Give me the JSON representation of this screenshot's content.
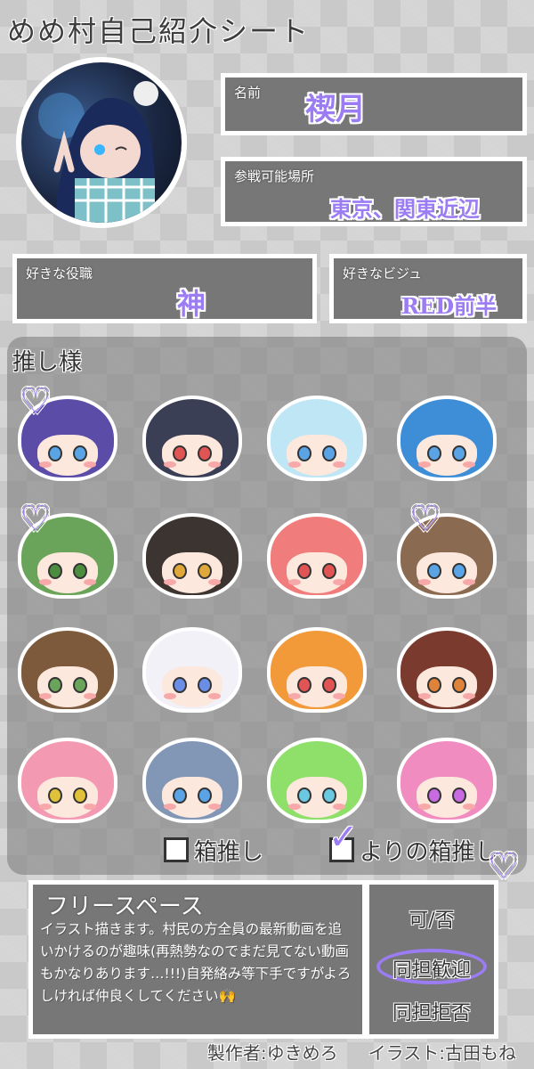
{
  "sheet": {
    "title": "めめ村自己紹介シート"
  },
  "profile": {
    "name_label": "名前",
    "name_value": "禊月",
    "area_label": "参戦可能場所",
    "area_value": "東京、関東近辺",
    "role_label": "好きな役職",
    "role_value": "神",
    "video_label": "好きなビジュ",
    "video_value": "RED前半"
  },
  "oshi": {
    "title": "推し様",
    "faces": [
      {
        "hair": "#5b4ca8",
        "eye": "#5aa4e6",
        "heart": true
      },
      {
        "hair": "#3a3f55",
        "eye": "#e05454",
        "heart": false
      },
      {
        "hair": "#bfe6f5",
        "eye": "#5aa4e6",
        "heart": false
      },
      {
        "hair": "#3d8ed6",
        "eye": "#5aa4e6",
        "heart": false
      },
      {
        "hair": "#6aa35a",
        "eye": "#4c8c3e",
        "heart": true
      },
      {
        "hair": "#3b3430",
        "eye": "#e0a73a",
        "heart": false
      },
      {
        "hair": "#f07c7c",
        "eye": "#e05454",
        "heart": false
      },
      {
        "hair": "#8b6a52",
        "eye": "#5aa4e6",
        "heart": true
      },
      {
        "hair": "#7d5a3c",
        "eye": "#6aa35a",
        "heart": false
      },
      {
        "hair": "#f1f1f7",
        "eye": "#6a8ee6",
        "heart": false
      },
      {
        "hair": "#f29a3a",
        "eye": "#e05454",
        "heart": false
      },
      {
        "hair": "#7a3b2e",
        "eye": "#e0833a",
        "heart": false
      },
      {
        "hair": "#f39ab2",
        "eye": "#e0c23a",
        "heart": false
      },
      {
        "hair": "#8296b5",
        "eye": "#5aa4e6",
        "heart": false
      },
      {
        "hair": "#8ee06a",
        "eye": "#6ac8e0",
        "heart": false
      },
      {
        "hair": "#f08cc0",
        "eye": "#c86ae0",
        "heart": false
      }
    ],
    "option_hako": "箱推し",
    "option_yori": "よりの箱推し",
    "heart_glyph": "♡",
    "check_glyph": "✓"
  },
  "free_space": {
    "title": "フリースペース",
    "text": "イラスト描きます。村民の方全員の最新動画を追いかけるのが趣味(再熱勢なのでまだ見てない動画もかなりあります…!!!)自発絡み等下手ですがよろしければ仲良くしてください🙌"
  },
  "doutan": {
    "option_1": "可/否",
    "option_2": "同担歓迎",
    "option_3": "同担拒否"
  },
  "footer": {
    "maker": "製作者:ゆきめろ",
    "illust": "イラスト:古田もね"
  },
  "colors": {
    "accent": "#9b7cf2",
    "box": "#777777"
  }
}
